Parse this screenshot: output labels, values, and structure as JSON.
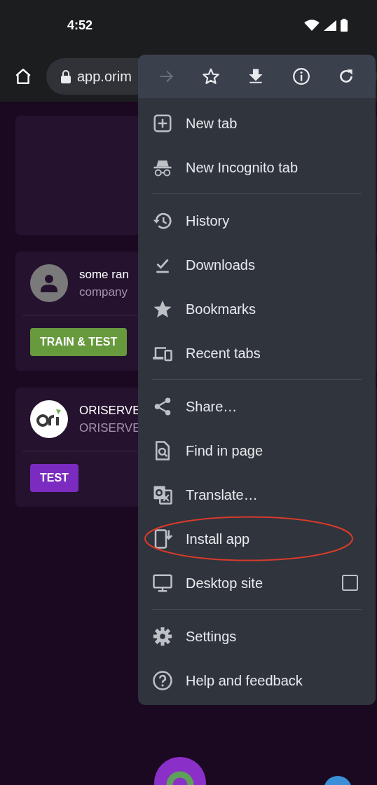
{
  "status_bar": {
    "time": "4:52"
  },
  "toolbar": {
    "url": "app.orim"
  },
  "cards": [
    {
      "kind": "empty"
    },
    {
      "kind": "person",
      "title": "some ran",
      "subtitle": "company",
      "button": "TRAIN & TEST",
      "color": "#67993d"
    },
    {
      "kind": "logo",
      "title": "ORISERVE",
      "subtitle": "ORISERVE",
      "button": "TEST",
      "color": "#7b2bbf"
    }
  ],
  "menu": {
    "actions": [
      {
        "disabled": true
      },
      {
        "disabled": false
      },
      {
        "disabled": false
      },
      {
        "disabled": false
      },
      {
        "disabled": false
      }
    ],
    "sections": [
      {
        "items": [
          {
            "kind": "item",
            "label": "New tab",
            "circled": false
          },
          {
            "kind": "item",
            "label": "New Incognito tab",
            "circled": false
          }
        ]
      },
      {
        "items": [
          {
            "kind": "item",
            "label": "History",
            "circled": false
          },
          {
            "kind": "item",
            "label": "Downloads",
            "circled": false
          },
          {
            "kind": "item",
            "label": "Bookmarks",
            "circled": false
          },
          {
            "kind": "item",
            "label": "Recent tabs",
            "circled": false
          }
        ]
      },
      {
        "items": [
          {
            "kind": "item",
            "label": "Share…",
            "circled": false
          },
          {
            "kind": "item",
            "label": "Find in page",
            "circled": false
          },
          {
            "kind": "item",
            "label": "Translate…",
            "circled": false
          },
          {
            "kind": "item",
            "label": "Install app",
            "circled": true
          },
          {
            "kind": "checkbox",
            "label": "Desktop site",
            "checked": false,
            "circled": false
          }
        ]
      },
      {
        "items": [
          {
            "kind": "item",
            "label": "Settings",
            "circled": false
          },
          {
            "kind": "item",
            "label": "Help and feedback",
            "circled": false
          }
        ]
      }
    ]
  }
}
